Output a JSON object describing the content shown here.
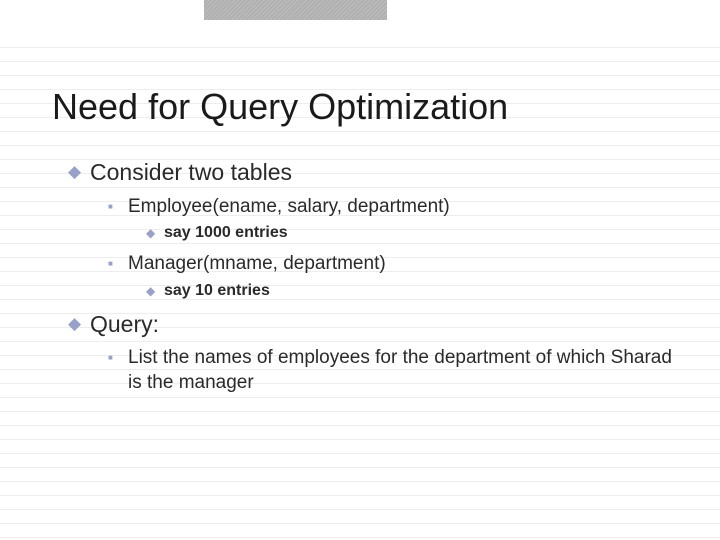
{
  "title": "Need for Query Optimization",
  "body": {
    "point1": {
      "text": "Consider two tables",
      "sub1": {
        "text": "Employee(ename, salary, department)",
        "detail": "say 1000 entries"
      },
      "sub2": {
        "text": "Manager(mname, department)",
        "detail": "say 10 entries"
      }
    },
    "point2": {
      "text": "Query:",
      "sub1": {
        "text": "List the names of employees for the department of which Sharad is the manager"
      }
    }
  }
}
